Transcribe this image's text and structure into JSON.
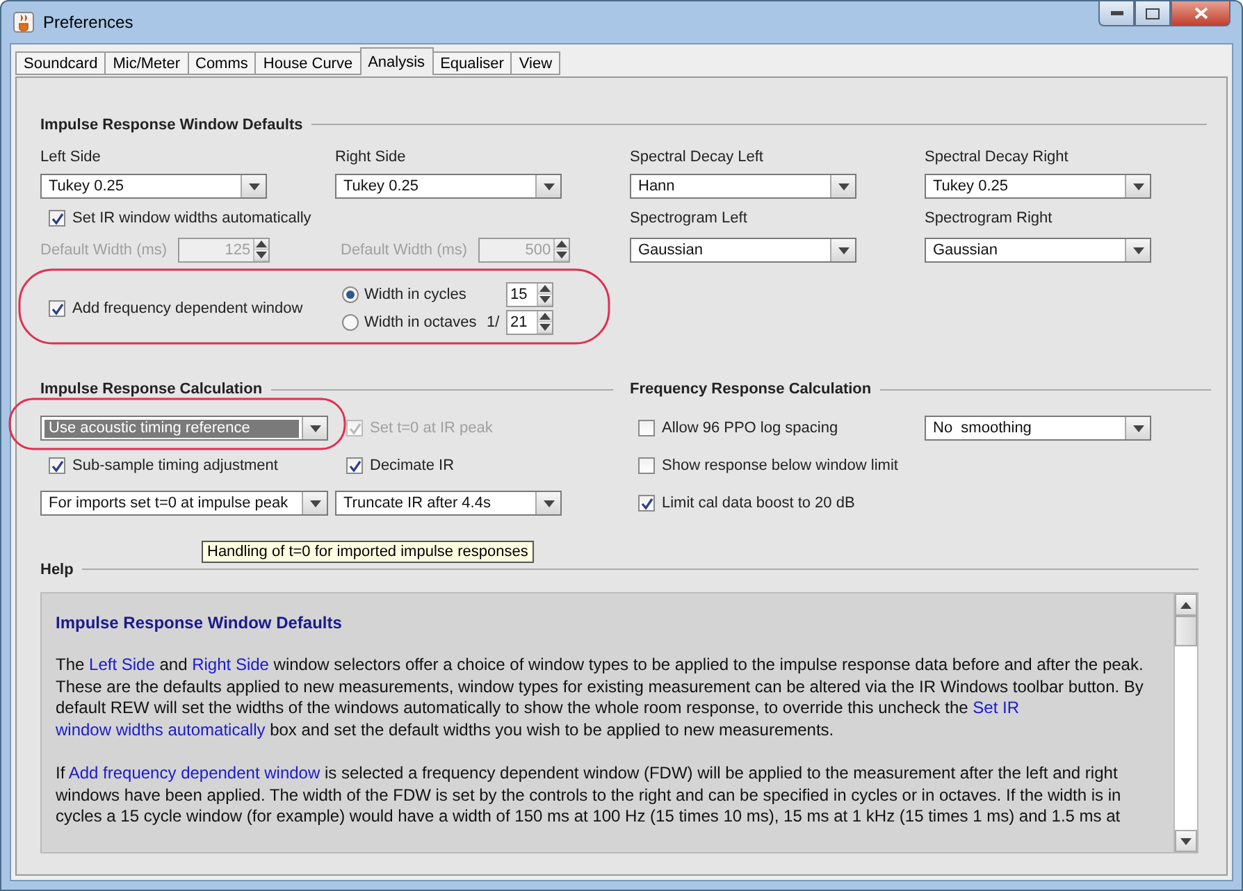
{
  "window": {
    "title": "Preferences"
  },
  "tabs": [
    {
      "label": "Soundcard",
      "selected": false
    },
    {
      "label": "Mic/Meter",
      "selected": false
    },
    {
      "label": "Comms",
      "selected": false
    },
    {
      "label": "House Curve",
      "selected": false
    },
    {
      "label": "Analysis",
      "selected": true
    },
    {
      "label": "Equaliser",
      "selected": false
    },
    {
      "label": "View",
      "selected": false
    }
  ],
  "ir_window": {
    "title": "Impulse Response Window Defaults",
    "left": {
      "label": "Left Side",
      "value": "Tukey 0.25"
    },
    "right": {
      "label": "Right Side",
      "value": "Tukey 0.25"
    },
    "auto_width": {
      "label": "Set IR window widths automatically",
      "checked": true
    },
    "left_default": {
      "label": "Default Width (ms)",
      "value": "125",
      "disabled": true
    },
    "right_default": {
      "label": "Default Width (ms)",
      "value": "500",
      "disabled": true
    },
    "fdw": {
      "label": "Add frequency dependent window",
      "checked": true
    },
    "cycles": {
      "label": "Width in cycles",
      "selected": true,
      "value": "15"
    },
    "octaves": {
      "label": "Width in octaves",
      "prefix": "1/",
      "selected": false,
      "value": "21"
    },
    "spectral": [
      {
        "label": "Spectral Decay Left",
        "value": "Hann"
      },
      {
        "label": "Spectral Decay Right",
        "value": "Tukey 0.25"
      },
      {
        "label": "Spectrogram Left",
        "value": "Gaussian"
      },
      {
        "label": "Spectrogram Right",
        "value": "Gaussian"
      }
    ]
  },
  "ir_calc": {
    "title": "Impulse Response Calculation",
    "timing": {
      "value": "Use acoustic timing reference",
      "selected": true
    },
    "t0_peak": {
      "label": "Set t=0 at IR peak",
      "checked": true,
      "disabled": true
    },
    "subsample": {
      "label": "Sub-sample timing adjustment",
      "checked": true,
      "disabled": false
    },
    "decimate": {
      "label": "Decimate IR",
      "checked": true,
      "disabled": false
    },
    "imports": {
      "value": "For imports set t=0 at impulse peak"
    },
    "truncate": {
      "value": "Truncate IR after 4.4s"
    }
  },
  "fr_calc": {
    "title": "Frequency Response Calculation",
    "checks": [
      {
        "label": "Allow 96 PPO log spacing",
        "checked": false,
        "disabled": false
      },
      {
        "label": "Show response below window limit",
        "checked": false,
        "disabled": false
      },
      {
        "label": "Limit cal data boost to 20 dB",
        "checked": true,
        "disabled": false
      }
    ],
    "smoothing": {
      "value": "No  smoothing"
    }
  },
  "tooltip": "Handling of t=0 for imported impulse responses",
  "help": {
    "title": "Help",
    "heading": "Impulse Response Window Defaults",
    "paragraphs": [
      [
        {
          "kind": "text",
          "text": "The "
        },
        {
          "kind": "link",
          "text": "Left Side"
        },
        {
          "kind": "text",
          "text": " and "
        },
        {
          "kind": "link",
          "text": "Right Side"
        },
        {
          "kind": "text",
          "text": " window selectors offer a choice of window types to be applied to the impulse response data before and after the peak. These are the defaults applied to new measurements, window types for existing measurement can be altered via the IR Windows toolbar button. By default REW will set the widths of the windows automatically to show the whole room response, to override this uncheck the "
        },
        {
          "kind": "link",
          "text": "Set IR"
        },
        {
          "kind": "link",
          "text": "window widths automatically"
        },
        {
          "kind": "text",
          "text": " box and set the default widths you wish to be applied to new measurements."
        }
      ],
      [
        {
          "kind": "text",
          "text": "If "
        },
        {
          "kind": "link",
          "text": "Add frequency dependent window"
        },
        {
          "kind": "text",
          "text": " is selected a frequency dependent window (FDW) will be applied to the measurement after the left and right windows have been applied. The width of the FDW is set by the controls to the right and can be specified in cycles or in octaves. If the width is in cycles a 15 cycle window (for example) would have a width of 150 ms at 100 Hz (15 times 10 ms), 15 ms at 1 kHz (15 times 1 ms) and 1.5 ms at"
        }
      ]
    ]
  }
}
